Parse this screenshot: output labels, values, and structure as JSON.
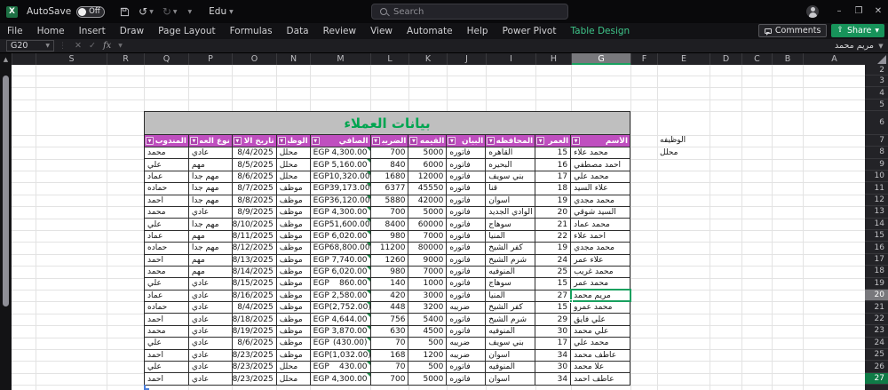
{
  "titlebar": {
    "autosave_label": "AutoSave",
    "autosave_state": "Off",
    "account_name": "Edu",
    "search_placeholder": "Search",
    "minimize": "–",
    "maximize": "❐",
    "close": "✕"
  },
  "ribbon": {
    "tabs": [
      "File",
      "Home",
      "Insert",
      "Draw",
      "Page Layout",
      "Formulas",
      "Data",
      "Review",
      "View",
      "Automate",
      "Help",
      "Power Pivot",
      "Table Design"
    ],
    "contextual_tab": "Table Design",
    "comments_label": "Comments",
    "share_label": "Share"
  },
  "formula_bar": {
    "name_box": "G20",
    "cancel": "✕",
    "enter": "✓",
    "fx_label": "fx",
    "value": "مريم محمد"
  },
  "sheet": {
    "columns": [
      "",
      "S",
      "R",
      "Q",
      "P",
      "O",
      "N",
      "M",
      "L",
      "K",
      "J",
      "I",
      "H",
      "G",
      "F",
      "E",
      "D",
      "C",
      "B",
      "A"
    ],
    "selected_column": "G",
    "selected_row": 20,
    "row_numbers": [
      2,
      3,
      4,
      5,
      6,
      7,
      8,
      9,
      10,
      11,
      12,
      13,
      14,
      15,
      16,
      17,
      18,
      19,
      20,
      21,
      22,
      23,
      24,
      25,
      26,
      27
    ]
  },
  "floating_cells": {
    "e7": "الوظيفه",
    "e8": "محلل"
  },
  "table": {
    "title": "بيانات العملاء",
    "currency": "EGP",
    "headers": {
      "name": "الأسم",
      "age": "العمر",
      "governorate": "المحافظه",
      "statement": "البيان",
      "value": "القيمه",
      "tax": "الضريبة",
      "net": "الصافي",
      "job": "الوظيفه",
      "join_date": "تاريخ الانضمام",
      "client_type": "نوع العميل",
      "agent": "المندوب"
    },
    "rows": [
      {
        "name": "محمد علاء",
        "age": "15",
        "governorate": "القاهره",
        "statement": "فاتوره",
        "value": "5000",
        "tax": "700",
        "net": "4,300.00",
        "job": "محلل",
        "join_date": "8/4/2025",
        "client_type": "عادي",
        "agent": "محمد"
      },
      {
        "name": "احمد مصطفي",
        "age": "16",
        "governorate": "البحيره",
        "statement": "فاتوره",
        "value": "6000",
        "tax": "840",
        "net": "5,160.00",
        "job": "محلل",
        "join_date": "8/5/2025",
        "client_type": "مهم",
        "agent": "علي"
      },
      {
        "name": "محمد علي",
        "age": "17",
        "governorate": "بني سويف",
        "statement": "فاتوره",
        "value": "12000",
        "tax": "1680",
        "net": "10,320.00",
        "job": "محلل",
        "join_date": "8/6/2025",
        "client_type": "مهم جدا",
        "agent": "عماد"
      },
      {
        "name": "علاء السيد",
        "age": "18",
        "governorate": "قنا",
        "statement": "فاتوره",
        "value": "45550",
        "tax": "6377",
        "net": "39,173.00",
        "job": "موظف",
        "join_date": "8/7/2025",
        "client_type": "مهم جدا",
        "agent": "حماده"
      },
      {
        "name": "محمد مجدي",
        "age": "19",
        "governorate": "اسوان",
        "statement": "فاتوره",
        "value": "42000",
        "tax": "5880",
        "net": "36,120.00",
        "job": "موظف",
        "join_date": "8/8/2025",
        "client_type": "مهم جدا",
        "agent": "احمد"
      },
      {
        "name": "السيد شوقي",
        "age": "20",
        "governorate": "الوادي الجديد",
        "statement": "فاتوره",
        "value": "5000",
        "tax": "700",
        "net": "4,300.00",
        "job": "موظف",
        "join_date": "8/9/2025",
        "client_type": "عادي",
        "agent": "محمد"
      },
      {
        "name": "محمد عماد",
        "age": "21",
        "governorate": "سوهاج",
        "statement": "فاتوره",
        "value": "60000",
        "tax": "8400",
        "net": "51,600.00",
        "job": "موظف",
        "join_date": "8/10/2025",
        "client_type": "مهم جدا",
        "agent": "علي"
      },
      {
        "name": "احمد علاء",
        "age": "22",
        "governorate": "المنيا",
        "statement": "فاتوره",
        "value": "7000",
        "tax": "980",
        "net": "6,020.00",
        "job": "موظف",
        "join_date": "8/11/2025",
        "client_type": "مهم",
        "agent": "عماد"
      },
      {
        "name": "محمد مجدي",
        "age": "19",
        "governorate": "كفر الشيخ",
        "statement": "فاتوره",
        "value": "80000",
        "tax": "11200",
        "net": "68,800.00",
        "job": "موظف",
        "join_date": "8/12/2025",
        "client_type": "مهم جدا",
        "agent": "حماده"
      },
      {
        "name": "علاء عمر",
        "age": "24",
        "governorate": "شرم الشيخ",
        "statement": "فاتوره",
        "value": "9000",
        "tax": "1260",
        "net": "7,740.00",
        "job": "موظف",
        "join_date": "8/13/2025",
        "client_type": "مهم",
        "agent": "احمد"
      },
      {
        "name": "محمد غريب",
        "age": "25",
        "governorate": "المنوفيه",
        "statement": "فاتوره",
        "value": "7000",
        "tax": "980",
        "net": "6,020.00",
        "job": "موظف",
        "join_date": "8/14/2025",
        "client_type": "مهم",
        "agent": "محمد"
      },
      {
        "name": "محمد عمر",
        "age": "15",
        "governorate": "سوهاج",
        "statement": "فاتوره",
        "value": "1000",
        "tax": "140",
        "net": "860.00",
        "job": "موظف",
        "join_date": "8/15/2025",
        "client_type": "عادي",
        "agent": "علي"
      },
      {
        "name": "مريم محمد",
        "age": "27",
        "governorate": "المنيا",
        "statement": "فاتوره",
        "value": "3000",
        "tax": "420",
        "net": "2,580.00",
        "job": "موظف",
        "join_date": "8/16/2025",
        "client_type": "عادي",
        "agent": "عماد"
      },
      {
        "name": "محمد عمرو",
        "age": "15",
        "governorate": "كفر الشيخ",
        "statement": "ضريبه",
        "value": "3200",
        "tax": "448",
        "net": "(2,752.00)",
        "job": "موظف",
        "join_date": "8/4/2025",
        "client_type": "عادي",
        "agent": "حماده"
      },
      {
        "name": "علي فايق",
        "age": "29",
        "governorate": "شرم الشيخ",
        "statement": "فاتوره",
        "value": "5400",
        "tax": "756",
        "net": "4,644.00",
        "job": "موظف",
        "join_date": "8/18/2025",
        "client_type": "عادي",
        "agent": "احمد"
      },
      {
        "name": "علي محمد",
        "age": "30",
        "governorate": "المنوفيه",
        "statement": "فاتوره",
        "value": "4500",
        "tax": "630",
        "net": "3,870.00",
        "job": "موظف",
        "join_date": "8/19/2025",
        "client_type": "عادي",
        "agent": "محمد"
      },
      {
        "name": "محمد علي",
        "age": "17",
        "governorate": "بني سويف",
        "statement": "ضريبه",
        "value": "500",
        "tax": "70",
        "net": "(430.00)",
        "job": "موظف",
        "join_date": "8/6/2025",
        "client_type": "عادي",
        "agent": "علي"
      },
      {
        "name": "عاطف محمد",
        "age": "34",
        "governorate": "اسوان",
        "statement": "ضريبه",
        "value": "1200",
        "tax": "168",
        "net": "(1,032.00)",
        "job": "موظف",
        "join_date": "8/23/2025",
        "client_type": "عادي",
        "agent": "احمد"
      },
      {
        "name": "علا محمد",
        "age": "30",
        "governorate": "المنوفيه",
        "statement": "فاتوره",
        "value": "500",
        "tax": "70",
        "net": "430.00",
        "job": "محلل",
        "join_date": "8/23/2025",
        "client_type": "عادي",
        "agent": "علي"
      },
      {
        "name": "عاطف احمد",
        "age": "34",
        "governorate": "اسوان",
        "statement": "فاتوره",
        "value": "5000",
        "tax": "700",
        "net": "4,300.00",
        "job": "محلل",
        "join_date": "8/23/2025",
        "client_type": "عادي",
        "agent": "احمد"
      }
    ]
  },
  "colors": {
    "table_header_bg": "#bf4fbf",
    "table_title_bg": "#bfbfbf",
    "table_title_text": "#00a550",
    "selection_green": "#18a05f",
    "share_button": "#17935a",
    "contextual_tab": "#3ec489"
  }
}
